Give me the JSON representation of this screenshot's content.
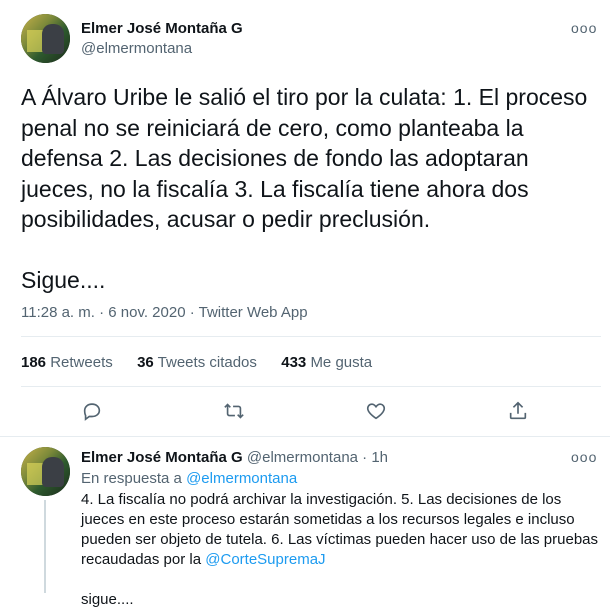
{
  "main_tweet": {
    "author_name": "Elmer José Montaña G",
    "author_handle": "@elmermontana",
    "more_label": "ooo",
    "text_lines": [
      "A Álvaro Uribe le salió el tiro por la culata: 1. El proceso",
      "penal no se reiniciará de cero, como planteaba la",
      "defensa 2. Las decisiones de fondo las adoptaran",
      "jueces, no la fiscalía 3. La fiscalía tiene ahora dos",
      "posibilidades, acusar o pedir preclusión."
    ],
    "text_tail": "Sigue....",
    "timestamp": "11:28 a. m. · 6 nov. 2020 · Twitter Web App",
    "stats": [
      {
        "count": "186",
        "label": "Retweets"
      },
      {
        "count": "36",
        "label": "Tweets citados"
      },
      {
        "count": "433",
        "label": "Me gusta"
      }
    ]
  },
  "reply_tweet": {
    "author_name": "Elmer José Montaña G",
    "author_handle": "@elmermontana",
    "separator": "·",
    "time": "1h",
    "more_label": "ooo",
    "in_reply_prefix": "En respuesta a",
    "in_reply_handle": "@elmermontana",
    "text_lines": [
      "4. La fiscalía no podrá archivar la investigación. 5. Las decisiones de los",
      "jueces en este proceso estarán sometidas a los recursos legales e incluso",
      "pueden ser objeto de tutela. 6. Las víctimas pueden hacer uso de las pruebas"
    ],
    "last_line_prefix": "recaudadas por la",
    "last_line_mention": "@CorteSupremaJ",
    "cut_line": "sigue...."
  },
  "actions": [
    "reply-icon",
    "retweet-icon",
    "like-icon",
    "share-icon"
  ],
  "colors": {
    "link": "#1d9bf0",
    "secondary": "#536471",
    "text": "#0f1419"
  }
}
